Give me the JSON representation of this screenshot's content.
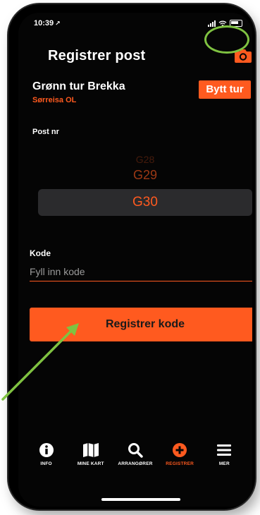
{
  "status_bar": {
    "time": "10:39",
    "location_glyph": "↗"
  },
  "header": {
    "title": "Registrer post",
    "camera_icon": "camera-icon"
  },
  "tour": {
    "name": "Grønn tur Brekka",
    "club": "Sørreisa OL",
    "switch_label": "Bytt tur"
  },
  "post_picker": {
    "label": "Post nr",
    "items": [
      "G28",
      "G29",
      "G30"
    ],
    "selected": "G30"
  },
  "code": {
    "label": "Kode",
    "placeholder": "Fyll inn kode",
    "value": ""
  },
  "register_button": {
    "label": "Registrer kode"
  },
  "tabs": [
    {
      "label": "INFO",
      "icon": "info-icon",
      "active": false
    },
    {
      "label": "MINE KART",
      "icon": "map-icon",
      "active": false
    },
    {
      "label": "ARRANGØRER",
      "icon": "search-icon",
      "active": false
    },
    {
      "label": "REGISTRER",
      "icon": "plus-circle-icon",
      "active": true
    },
    {
      "label": "MER",
      "icon": "menu-icon",
      "active": false
    }
  ],
  "colors": {
    "accent": "#ff5a1f",
    "background": "#050505",
    "annotation": "#7fc241",
    "picker_band": "#2b2b2d"
  }
}
